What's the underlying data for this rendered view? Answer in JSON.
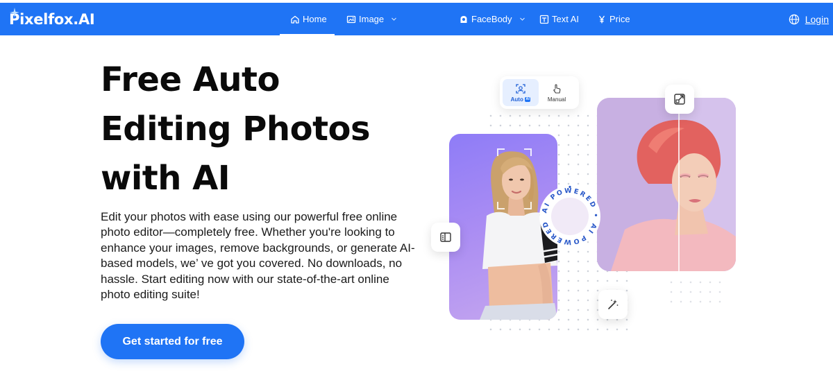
{
  "nav": {
    "logo": "Pixelfox.AI",
    "items": [
      {
        "label": "Home",
        "icon": "home-icon",
        "active": true,
        "dropdown": false
      },
      {
        "label": "Image",
        "icon": "image-icon",
        "active": false,
        "dropdown": true
      },
      {
        "label": "FaceBody",
        "icon": "face-body-icon",
        "active": false,
        "dropdown": true
      },
      {
        "label": "Text AI",
        "icon": "text-ai-icon",
        "active": false,
        "dropdown": false
      },
      {
        "label": "Price",
        "icon": "yen-icon",
        "active": false,
        "dropdown": false
      }
    ],
    "login_label": "Login",
    "language_icon": "globe-icon"
  },
  "hero": {
    "title": "Free Auto Editing Photos with AI",
    "description": "Edit your photos with ease using our powerful free online photo editor—completely free. Whether you're looking to enhance your images, remove backgrounds, or generate AI-based models, we’ ve got you covered. No downloads, no hassle. Start editing now with our state-of-the-art online photo editing suite!",
    "cta_label": "Get started for free"
  },
  "illustration": {
    "mode_toggle": {
      "auto_label": "Auto",
      "auto_badge": "AI",
      "manual_label": "Manual",
      "selected": "Auto"
    },
    "ai_badge_text": "AI POWERED",
    "icons": [
      "compare-icon",
      "expand-icon",
      "magic-wand-icon"
    ]
  },
  "colors": {
    "brand_blue": "#1f74f5",
    "toggle_selected_bg": "#e6efff",
    "card_left_purple": "#a98cf3",
    "card_right_lavender": "#c4aee0"
  }
}
